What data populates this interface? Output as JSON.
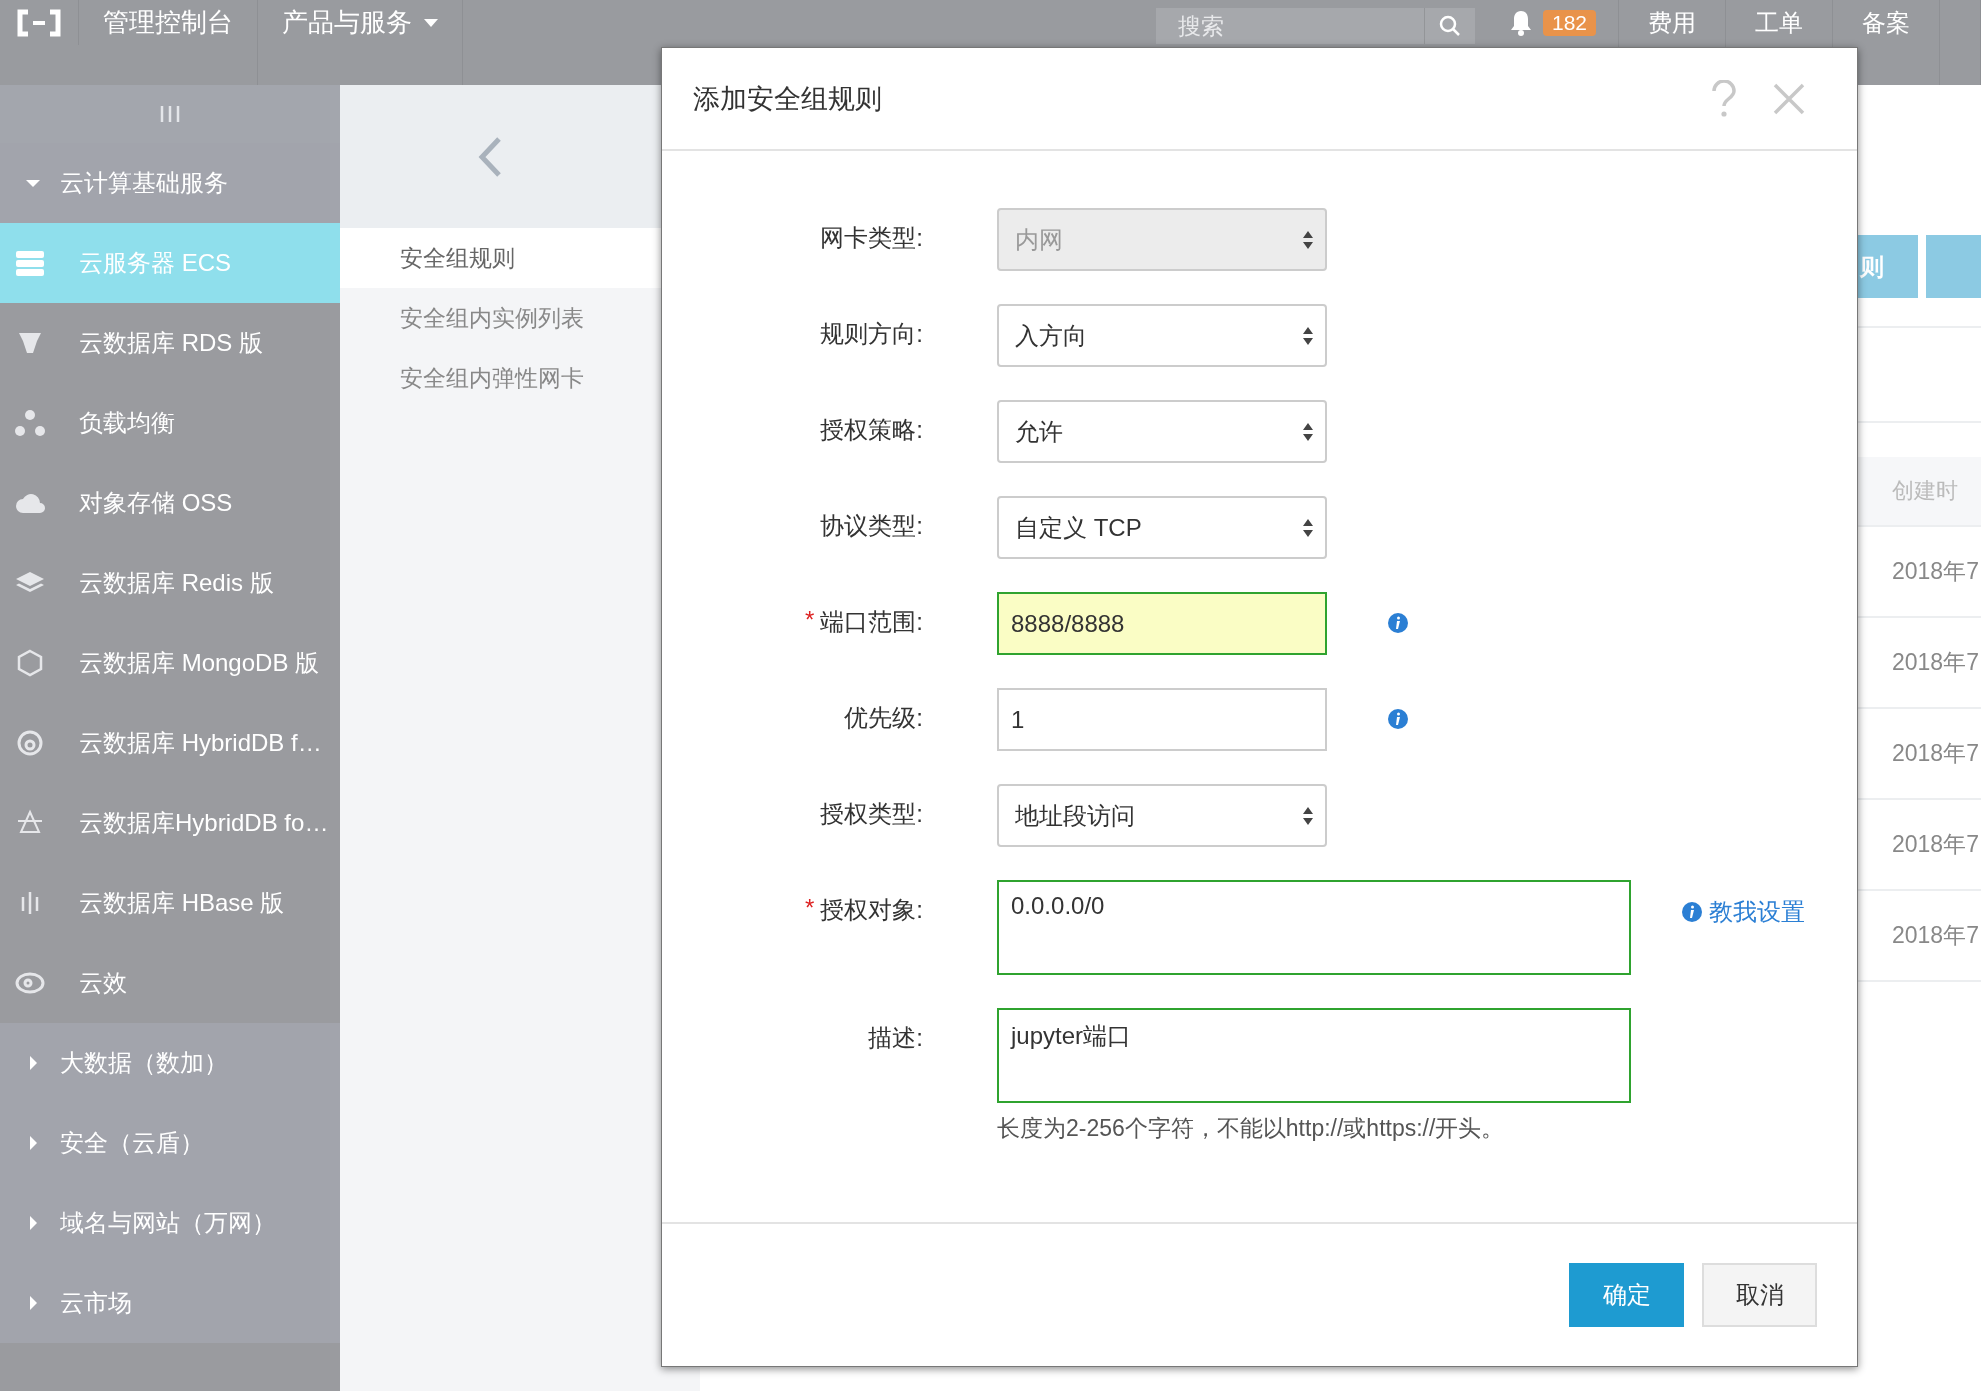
{
  "top_bar": {
    "nav": [
      {
        "label": "管理控制台",
        "dropdown": false
      },
      {
        "label": "产品与服务",
        "dropdown": true
      }
    ],
    "search": {
      "placeholder": "搜索"
    },
    "notifications": "182",
    "links": [
      "费用",
      "工单",
      "备案"
    ]
  },
  "sidebar": {
    "groups": [
      {
        "label": "云计算基础服务",
        "expanded": true,
        "children": [
          {
            "label": "云服务器 ECS",
            "selected": true
          },
          {
            "label": "云数据库 RDS 版",
            "selected": false
          },
          {
            "label": "负载均衡",
            "selected": false
          },
          {
            "label": "对象存储 OSS",
            "selected": false
          },
          {
            "label": "云数据库 Redis 版",
            "selected": false
          },
          {
            "label": "云数据库 MongoDB 版",
            "selected": false
          },
          {
            "label": "云数据库 HybridDB f…",
            "selected": false
          },
          {
            "label": "云数据库HybridDB fo…",
            "selected": false
          },
          {
            "label": "云数据库 HBase 版",
            "selected": false
          },
          {
            "label": "云效",
            "selected": false
          }
        ]
      },
      {
        "label": "大数据（数加）",
        "expanded": false
      },
      {
        "label": "安全（云盾）",
        "expanded": false
      },
      {
        "label": "域名与网站（万网）",
        "expanded": false
      },
      {
        "label": "云市场",
        "expanded": false
      }
    ]
  },
  "sub_nav": [
    {
      "label": "安全组规则",
      "selected": true
    },
    {
      "label": "安全组内实例列表",
      "selected": false
    },
    {
      "label": "安全组内弹性网卡",
      "selected": false
    }
  ],
  "content": {
    "buttons": [
      "则"
    ],
    "table": {
      "columns": [
        "创建时"
      ],
      "rows": [
        [
          "2018年7"
        ],
        [
          "2018年7"
        ],
        [
          "2018年7"
        ],
        [
          "2018年7"
        ],
        [
          "2018年7"
        ]
      ]
    }
  },
  "dialog": {
    "title": "添加安全组规则",
    "fields": [
      {
        "kind": "select",
        "label": "网卡类型:",
        "value": "内网",
        "disabled": true
      },
      {
        "kind": "select",
        "label": "规则方向:",
        "value": "入方向",
        "disabled": false
      },
      {
        "kind": "select",
        "label": "授权策略:",
        "value": "允许",
        "disabled": false
      },
      {
        "kind": "select",
        "label": "协议类型:",
        "value": "自定义 TCP",
        "disabled": false
      },
      {
        "kind": "input",
        "label": "端口范围:",
        "value": "8888/8888",
        "required_mark": "*",
        "valid": true,
        "autofilled": true,
        "info": true
      },
      {
        "kind": "input",
        "label": "优先级:",
        "value": "1",
        "valid": false,
        "autofilled": false,
        "info": true
      },
      {
        "kind": "select",
        "label": "授权类型:",
        "value": "地址段访问",
        "disabled": false
      },
      {
        "kind": "textarea",
        "label": "授权对象:",
        "value": "0.0.0.0/0",
        "required_mark": "*",
        "valid": true,
        "help_link": "教我设置"
      },
      {
        "kind": "textarea",
        "label": "描述:",
        "value": "jupyter端口",
        "valid": true,
        "hint": "长度为2-256个字符，不能以http://或https://开头。"
      }
    ],
    "buttons": [
      {
        "label": "确定",
        "primary": true
      },
      {
        "label": "取消",
        "primary": false
      }
    ]
  }
}
